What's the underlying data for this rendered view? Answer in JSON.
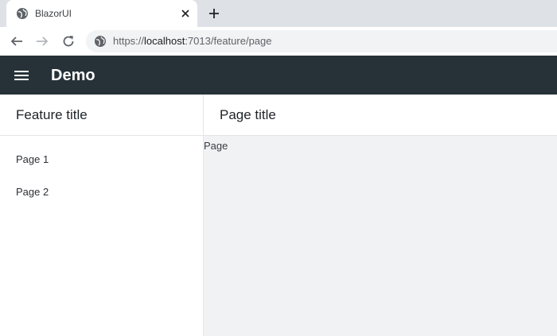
{
  "browser": {
    "tab_title": "BlazorUI",
    "url_scheme": "https://",
    "url_host": "localhost",
    "url_rest": ":7013/feature/page",
    "colors": {
      "tabstrip": "#dee1e6",
      "omnibox": "#f1f3f4"
    }
  },
  "appbar": {
    "title": "Demo",
    "color": "#263238"
  },
  "sidebar": {
    "title": "Feature title",
    "items": [
      {
        "label": "Page 1"
      },
      {
        "label": "Page 2"
      }
    ]
  },
  "main": {
    "title": "Page title",
    "content": "Page"
  }
}
